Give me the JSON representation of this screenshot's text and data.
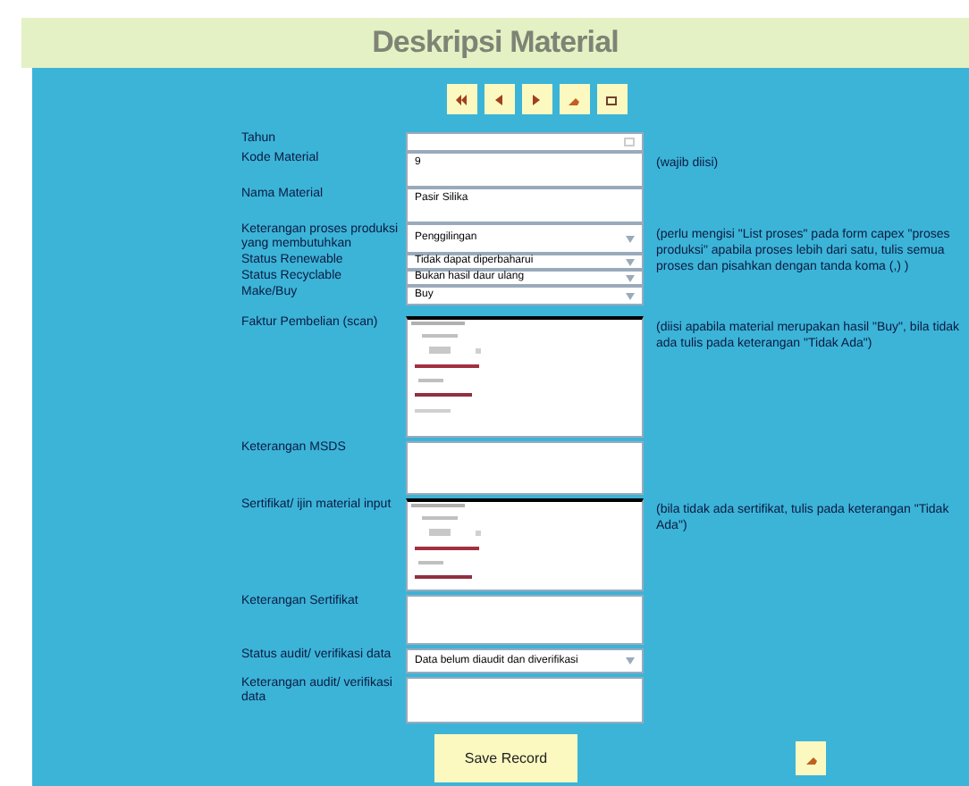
{
  "title": "Deskripsi Material",
  "fields": [
    {
      "label": "Tahun",
      "kind": "date"
    },
    {
      "label": "Kode Material",
      "kind": "text",
      "value": "9",
      "note": "(wajib diisi)"
    },
    {
      "label": "Nama Material",
      "kind": "text",
      "value": "Pasir Silika"
    },
    {
      "label": "Keterangan proses produksi yang membutuhkan",
      "kind": "select",
      "value": "Penggilingan",
      "note": "(perlu mengisi \"List proses\" pada form capex \"proses produksi\" apabila proses lebih dari satu, tulis semua proses dan pisahkan dengan tanda koma (,) )"
    },
    {
      "label": "Status Renewable",
      "kind": "select",
      "value": "Tidak dapat diperbaharui"
    },
    {
      "label": "Status Recyclable",
      "kind": "select",
      "value": "Bukan hasil daur ulang"
    },
    {
      "label": "Make/Buy",
      "kind": "select",
      "value": "Buy"
    },
    {
      "label": "Faktur Pembelian (scan)",
      "kind": "attachment",
      "note": "(diisi apabila material merupakan hasil \"Buy\", bila tidak ada tulis pada keterangan \"Tidak Ada\")"
    },
    {
      "label": "Keterangan MSDS",
      "kind": "text"
    },
    {
      "label": "Sertifikat/ ijin material input",
      "kind": "attachment",
      "note": "(bila tidak ada sertifikat, tulis pada keterangan \"Tidak Ada\")"
    },
    {
      "label": "Keterangan Sertifikat",
      "kind": "text"
    },
    {
      "label": "Status audit/ verifikasi data",
      "kind": "select",
      "value": "Data belum diaudit dan diverifikasi"
    },
    {
      "label": "Keterangan audit/ verifikasi data",
      "kind": "text"
    }
  ],
  "save_button": "Save Record"
}
